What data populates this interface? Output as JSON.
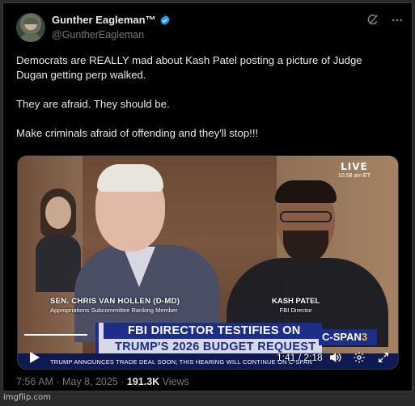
{
  "author": {
    "display_name": "Gunther Eagleman™",
    "handle": "@GuntherEagleman",
    "verified": true
  },
  "tweet": {
    "lines": [
      "Democrats are REALLY mad about Kash Patel posting a picture of Judge Dugan getting perp walked.",
      "They are afraid. They should be.",
      "Make criminals afraid of offending and they'll stop!!!"
    ]
  },
  "media": {
    "live_label": "LIVE",
    "live_time": "10:58 am ET",
    "left_caption_name": "SEN. CHRIS VAN HOLLEN (D-MD)",
    "left_caption_title": "Appropriations Subcommittee Ranking Member",
    "right_caption_name": "KASH PATEL",
    "right_caption_title": "FBI Director",
    "banner_line1": "FBI DIRECTOR TESTIFIES ON",
    "banner_line2": "TRUMP'S 2026 BUDGET REQUEST",
    "network_name": "C-SPAN",
    "network_number": "3",
    "ticker": "TRUMP ANNOUNCES TRADE DEAL SOON; THIS HEARING WILL CONTINUE ON C-SPAN",
    "elapsed_time": "1:41 / 2:18",
    "progress_fraction": 0.17
  },
  "meta": {
    "timestamp": "7:56 AM · May 8, 2025 · ",
    "views_count": "191.3K",
    "views_label": " Views"
  },
  "footer": {
    "watermark": "imgflip.com"
  },
  "colors": {
    "background": "#000000",
    "text_primary": "#e7e9ea",
    "text_secondary": "#71767b",
    "verified_blue": "#1d9bf0",
    "cspan_blue": "#1d2e8a"
  },
  "icons": {
    "grok": "grok-icon",
    "more": "more-icon",
    "play": "play-icon",
    "volume": "volume-icon",
    "settings": "settings-icon",
    "fullscreen": "fullscreen-icon",
    "verified": "verified-badge-icon"
  }
}
